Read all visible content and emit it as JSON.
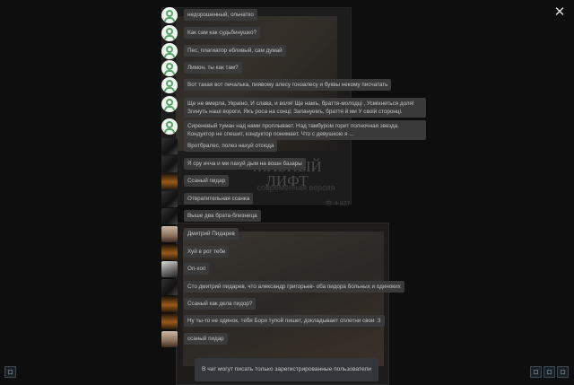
{
  "background": {
    "article_title": "…ЛЬНЫЙ ЛИФТ",
    "article_subtitle": "современная версия",
    "article_meta": "👁 4 927"
  },
  "close_icon": "close-icon",
  "messages": [
    {
      "avatar": "green",
      "text": "недорошенный, ольчатко"
    },
    {
      "avatar": "green",
      "text": "Как сам как судьбинушко?"
    },
    {
      "avatar": "green",
      "text": "Пес, плагиатор ебливый, сам думай"
    },
    {
      "avatar": "green",
      "text": "Лимон, ты как там?"
    },
    {
      "avatar": "green",
      "text": "Вот такая вот печалька, пиявому алесу гонзалесу и буквы некому писчатать"
    },
    {
      "avatar": "green",
      "text": "Ще не вмерла, Украіно, И слава, и воля! Ще намъ, браття-молодці , Усміхнеться доля! Згинуть наші вороги, Якъ роса на сонці; Запануемъ, браття й ми У своій сторонці."
    },
    {
      "avatar": "green",
      "text": "Сиреневый туман над нами проплывает. Над тамбуром горит полночная звезда. Кондуктор не спешит, кондуктор понимает. Что с девушкою я ..."
    },
    {
      "avatar": "dark",
      "text": "Вротбралес, полез нахуй отсюда"
    },
    {
      "avatar": "dark",
      "text": "Я сру ичча и ми пахуй дым на вошн базары"
    },
    {
      "avatar": "fire",
      "text": "Ссаный пидар"
    },
    {
      "avatar": "dark",
      "text": "Отвратительная ссанка"
    },
    {
      "avatar": "dark",
      "text": "Выше два брата-близнеца"
    },
    {
      "avatar": "face",
      "text": "Дмитрий Пидарев"
    },
    {
      "avatar": "fire",
      "text": "Хуй в рот тебе"
    },
    {
      "avatar": "bw",
      "text": "Оп-хоп"
    },
    {
      "avatar": "dark",
      "text": "Сто дмитрий пидарев, что александр григорьев- оба пидора больных и одиноких"
    },
    {
      "avatar": "fire",
      "text": "Ссаный как дела пидор?"
    },
    {
      "avatar": "fire",
      "text": "Ну ты-то не одинок, тебя Боря тупой пишет, докладывает сплетни свои :3"
    },
    {
      "avatar": "face",
      "text": "ссаный пидар"
    }
  ],
  "notice": "В чат могут писать только зарегистрированные пользователи"
}
